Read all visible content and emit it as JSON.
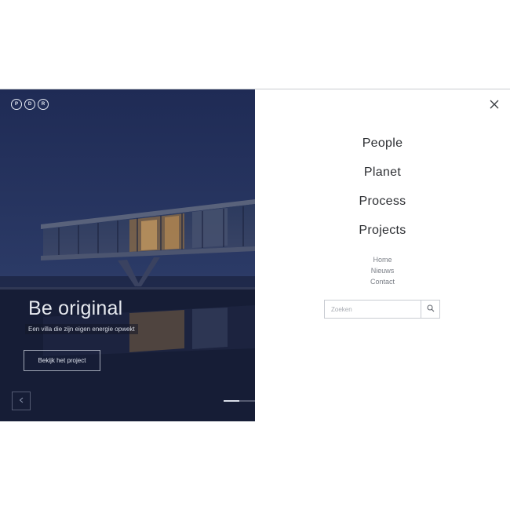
{
  "logo": {
    "letters": [
      "P",
      "D",
      "R"
    ]
  },
  "hero": {
    "title": "Be original",
    "subtitle": "Een villa die zijn eigen energie opwekt",
    "cta_label": "Bekijk het project",
    "prev_icon": "chevron-left-icon",
    "slide_indicator": {
      "active_index": 0,
      "count": 2
    }
  },
  "menu": {
    "close_icon": "close-icon",
    "primary": [
      "People",
      "Planet",
      "Process",
      "Projects"
    ],
    "secondary": [
      "Home",
      "Nieuws",
      "Contact"
    ],
    "search": {
      "placeholder": "Zoeken",
      "value": "",
      "button_icon": "search-icon"
    }
  },
  "colors": {
    "hero_bg": "#243463",
    "text_dark": "#2d2f33",
    "text_muted": "#7b7f87",
    "border": "#c9ccd2"
  }
}
